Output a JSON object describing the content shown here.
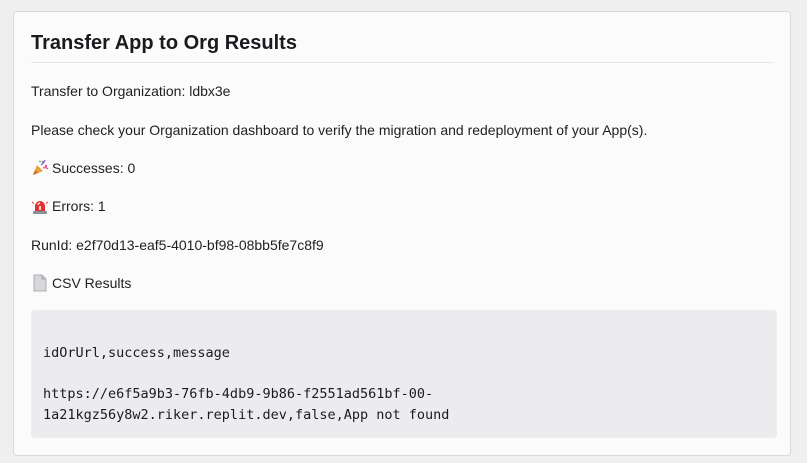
{
  "card": {
    "title": "Transfer App to Org Results",
    "transfer_line": "Transfer to Organization: ldbx3e",
    "instruction": "Please check your Organization dashboard to verify the migration and redeployment of your App(s).",
    "successes_label": "Successes: 0",
    "errors_label": "Errors: 1",
    "run_id_line": "RunId: e2f70d13-eaf5-4010-bf98-08bb5fe7c8f9",
    "csv_results_label": "CSV Results",
    "icons": {
      "successes": "party-popper-icon",
      "errors": "siren-icon",
      "csv": "document-icon"
    }
  },
  "csv": {
    "header": "idOrUrl,success,message",
    "row_line1": "https://e6f5a9b3-76fb-4db9-9b86-f2551ad561bf-00-",
    "row_line2": "1a21kgz56y8w2.riker.replit.dev,false,App not found"
  },
  "colors": {
    "background": "#efeff0",
    "card": "#fbfbfb",
    "code_background": "#ececee",
    "text": "#1b1b1f"
  }
}
